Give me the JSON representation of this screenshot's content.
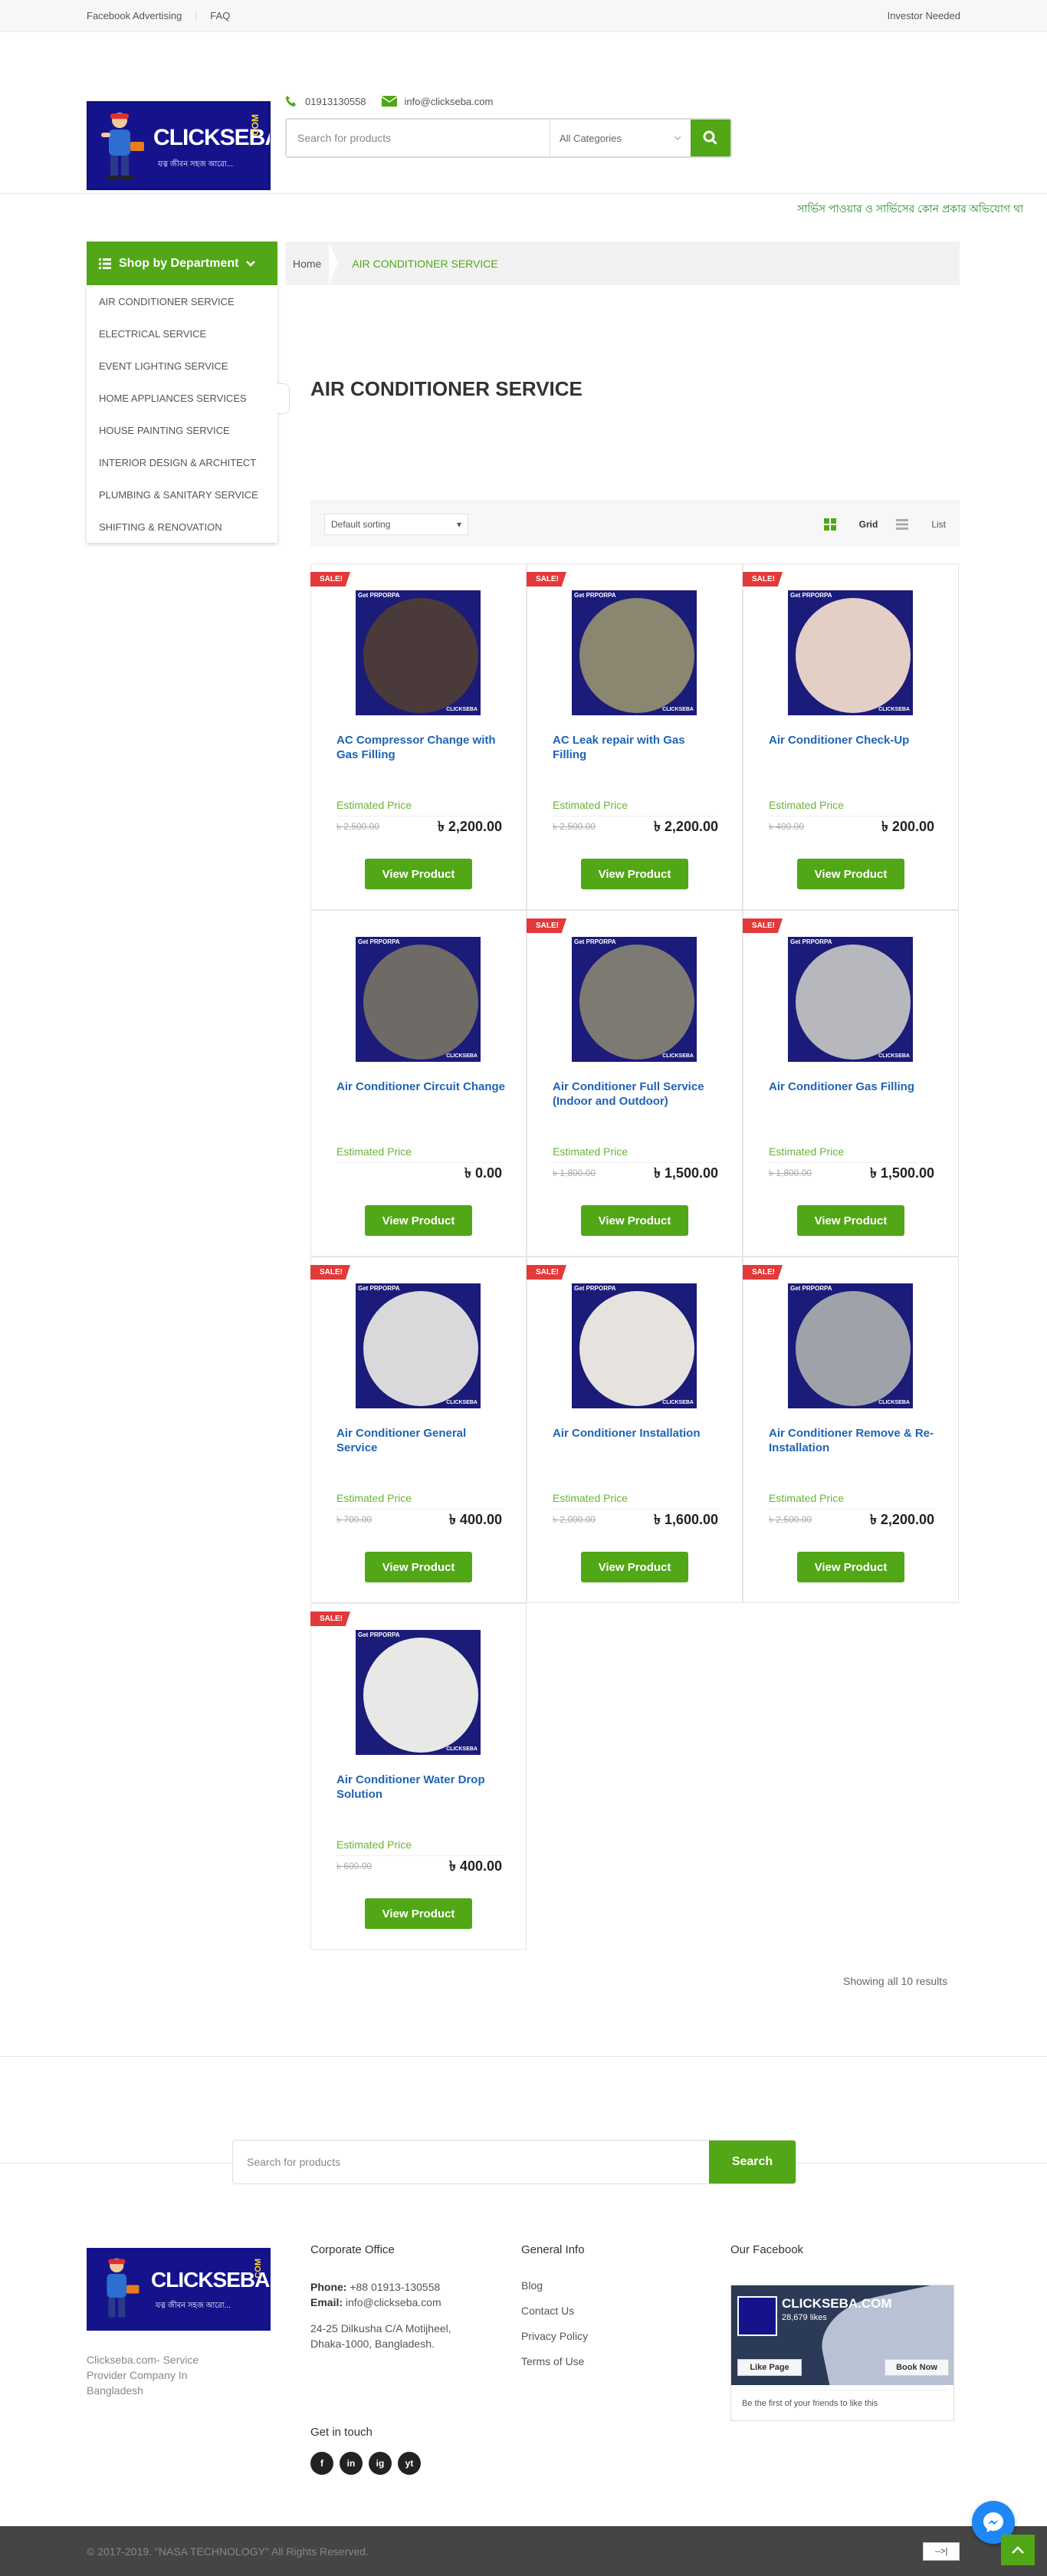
{
  "topbar": {
    "links": [
      "Facebook Advertising",
      "FAQ"
    ],
    "right": "Investor Needed"
  },
  "header": {
    "logo_brand": "CLICKSEBA",
    "logo_dotcom": ".COM",
    "logo_tagline": "যত্ন জীবন সহজ আরো...",
    "phone": "01913130558",
    "email": "info@clickseba.com",
    "search_placeholder": "Search for products",
    "category_select": "All Categories"
  },
  "marquee": "সার্ভিস পাওয়ার ও সার্ভিসের কোন প্রকার অভিযোগ থা",
  "department": {
    "label": "Shop by Department",
    "items": [
      "AIR CONDITIONER SERVICE",
      "ELECTRICAL SERVICE",
      "EVENT LIGHTING SERVICE",
      "HOME APPLIANCES SERVICES",
      "HOUSE PAINTING SERVICE",
      "INTERIOR DESIGN & ARCHITECT",
      "PLUMBING & SANITARY SERVICE",
      "SHIFTING & RENOVATION"
    ]
  },
  "breadcrumb": {
    "home": "Home",
    "current": "AIR CONDITIONER SERVICE"
  },
  "page_title": "AIR CONDITIONER SERVICE",
  "toolbar": {
    "sort": "Default sorting",
    "grid": "Grid",
    "list": "List"
  },
  "products": [
    {
      "name": "AC Compressor Change with Gas Filling",
      "sale": "SALE!",
      "est": "Estimated Price",
      "old": "৳ 2,500.00",
      "price": "৳ 2,200.00",
      "btn": "View Product",
      "img_color": "#4a3a3a"
    },
    {
      "name": "AC Leak repair with Gas Filling",
      "sale": "SALE!",
      "est": "Estimated Price",
      "old": "৳ 2,500.00",
      "price": "৳ 2,200.00",
      "btn": "View Product",
      "img_color": "#8a8670"
    },
    {
      "name": "Air Conditioner Check-Up",
      "sale": "SALE!",
      "est": "Estimated Price",
      "old": "৳ 400.00",
      "price": "৳ 200.00",
      "btn": "View Product",
      "img_color": "#e3cfc6"
    },
    {
      "name": "Air Conditioner Circuit Change",
      "sale": "",
      "est": "Estimated Price",
      "old": "",
      "price": "৳ 0.00",
      "btn": "View Product",
      "img_color": "#6e6a66"
    },
    {
      "name": "Air Conditioner Full Service (Indoor and Outdoor)",
      "sale": "SALE!",
      "est": "Estimated Price",
      "old": "৳ 1,800.00",
      "price": "৳ 1,500.00",
      "btn": "View Product",
      "img_color": "#7d7a74"
    },
    {
      "name": "Air Conditioner Gas Filling",
      "sale": "SALE!",
      "est": "Estimated Price",
      "old": "৳ 1,800.00",
      "price": "৳ 1,500.00",
      "btn": "View Product",
      "img_color": "#b6b8bd"
    },
    {
      "name": "Air Conditioner General Service",
      "sale": "SALE!",
      "est": "Estimated Price",
      "old": "৳ 700.00",
      "price": "৳ 400.00",
      "btn": "View Product",
      "img_color": "#d9d9dc"
    },
    {
      "name": "Air Conditioner Installation",
      "sale": "SALE!",
      "est": "Estimated Price",
      "old": "৳ 2,000.00",
      "price": "৳ 1,600.00",
      "btn": "View Product",
      "img_color": "#e6e3df"
    },
    {
      "name": "Air Conditioner Remove & Re-Installation",
      "sale": "SALE!",
      "est": "Estimated Price",
      "old": "৳ 2,500.00",
      "price": "৳ 2,200.00",
      "btn": "View Product",
      "img_color": "#9fa3a9"
    },
    {
      "name": "Air Conditioner Water Drop Solution",
      "sale": "SALE!",
      "est": "Estimated Price",
      "old": "৳ 600.00",
      "price": "৳ 400.00",
      "btn": "View Product",
      "img_color": "#e8e8e6"
    }
  ],
  "img_badge": "Get PRPORPA",
  "img_mark": "CLICKSEBA",
  "showing": "Showing all 10 results",
  "footer_search": {
    "placeholder": "Search for products",
    "button": "Search"
  },
  "footer": {
    "desc": "Clickseba.com- Service Provider Company In Bangladesh",
    "corporate_title": "Corporate Office",
    "phone_label": "Phone:",
    "phone": "+88 01913-130558",
    "email_label": "Email:",
    "email": "info@clickseba.com",
    "address": "24-25 Dilkusha C/A Motijheel, Dhaka-1000, Bangladesh.",
    "general_title": "General Info",
    "general_links": [
      "Blog",
      "Contact Us",
      "Privacy Policy",
      "Terms of Use"
    ],
    "facebook_title": "Our Facebook",
    "fb_page": "CLICKSEBA.COM",
    "fb_likes": "28,679 likes",
    "fb_like_btn": "Like Page",
    "fb_book_btn": "Book Now",
    "fb_friends": "Be the first of your friends to like this",
    "get_in_touch": "Get in touch",
    "social": [
      "f",
      "in",
      "ig",
      "yt"
    ]
  },
  "copyright": "© 2017-2019. \"NASA TECHNOLOGY\" All Rights Reserved.",
  "colors": {
    "accent": "#51a716",
    "link": "#1f64b4",
    "sale": "#e23a3a",
    "brand_blue": "#14138c"
  }
}
